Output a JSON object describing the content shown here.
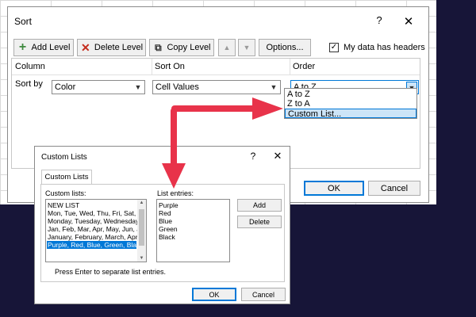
{
  "sort_dialog": {
    "title": "Sort",
    "help": "?",
    "close": "✕",
    "toolbar": {
      "add_level": "Add Level",
      "delete_level": "Delete Level",
      "copy_level": "Copy Level",
      "move_up": "▲",
      "move_down": "▼",
      "options": "Options...",
      "has_headers_label": "My data has headers",
      "has_headers_checked": "✓"
    },
    "headers": {
      "column": "Column",
      "sort_on": "Sort On",
      "order": "Order"
    },
    "row": {
      "label": "Sort by",
      "column_value": "Color",
      "sort_on_value": "Cell Values",
      "order_value": "A to Z"
    },
    "order_menu": [
      "A to Z",
      "Z to A",
      "Custom List..."
    ],
    "order_menu_selected": "Custom List...",
    "ok": "OK",
    "cancel": "Cancel"
  },
  "custom_lists_dialog": {
    "title": "Custom Lists",
    "help": "?",
    "close": "✕",
    "tab": "Custom Lists",
    "custom_lists_label": "Custom lists:",
    "custom_lists": [
      "NEW LIST",
      "Mon, Tue, Wed, Thu, Fri, Sat, S",
      "Monday, Tuesday, Wednesday",
      "Jan, Feb, Mar, Apr, May, Jun, J",
      "January, February, March, Apri",
      "Purple, Red, Blue, Green, Black"
    ],
    "selected_list": "Purple, Red, Blue, Green, Black",
    "list_entries_label": "List entries:",
    "list_entries": [
      "Purple",
      "Red",
      "Blue",
      "Green",
      "Black"
    ],
    "add": "Add",
    "delete": "Delete",
    "hint": "Press Enter to separate list entries.",
    "ok": "OK",
    "cancel": "Cancel"
  },
  "colors": {
    "accent": "#0078d7",
    "annotation_arrow": "#e8334a",
    "backdrop": "#171538"
  }
}
